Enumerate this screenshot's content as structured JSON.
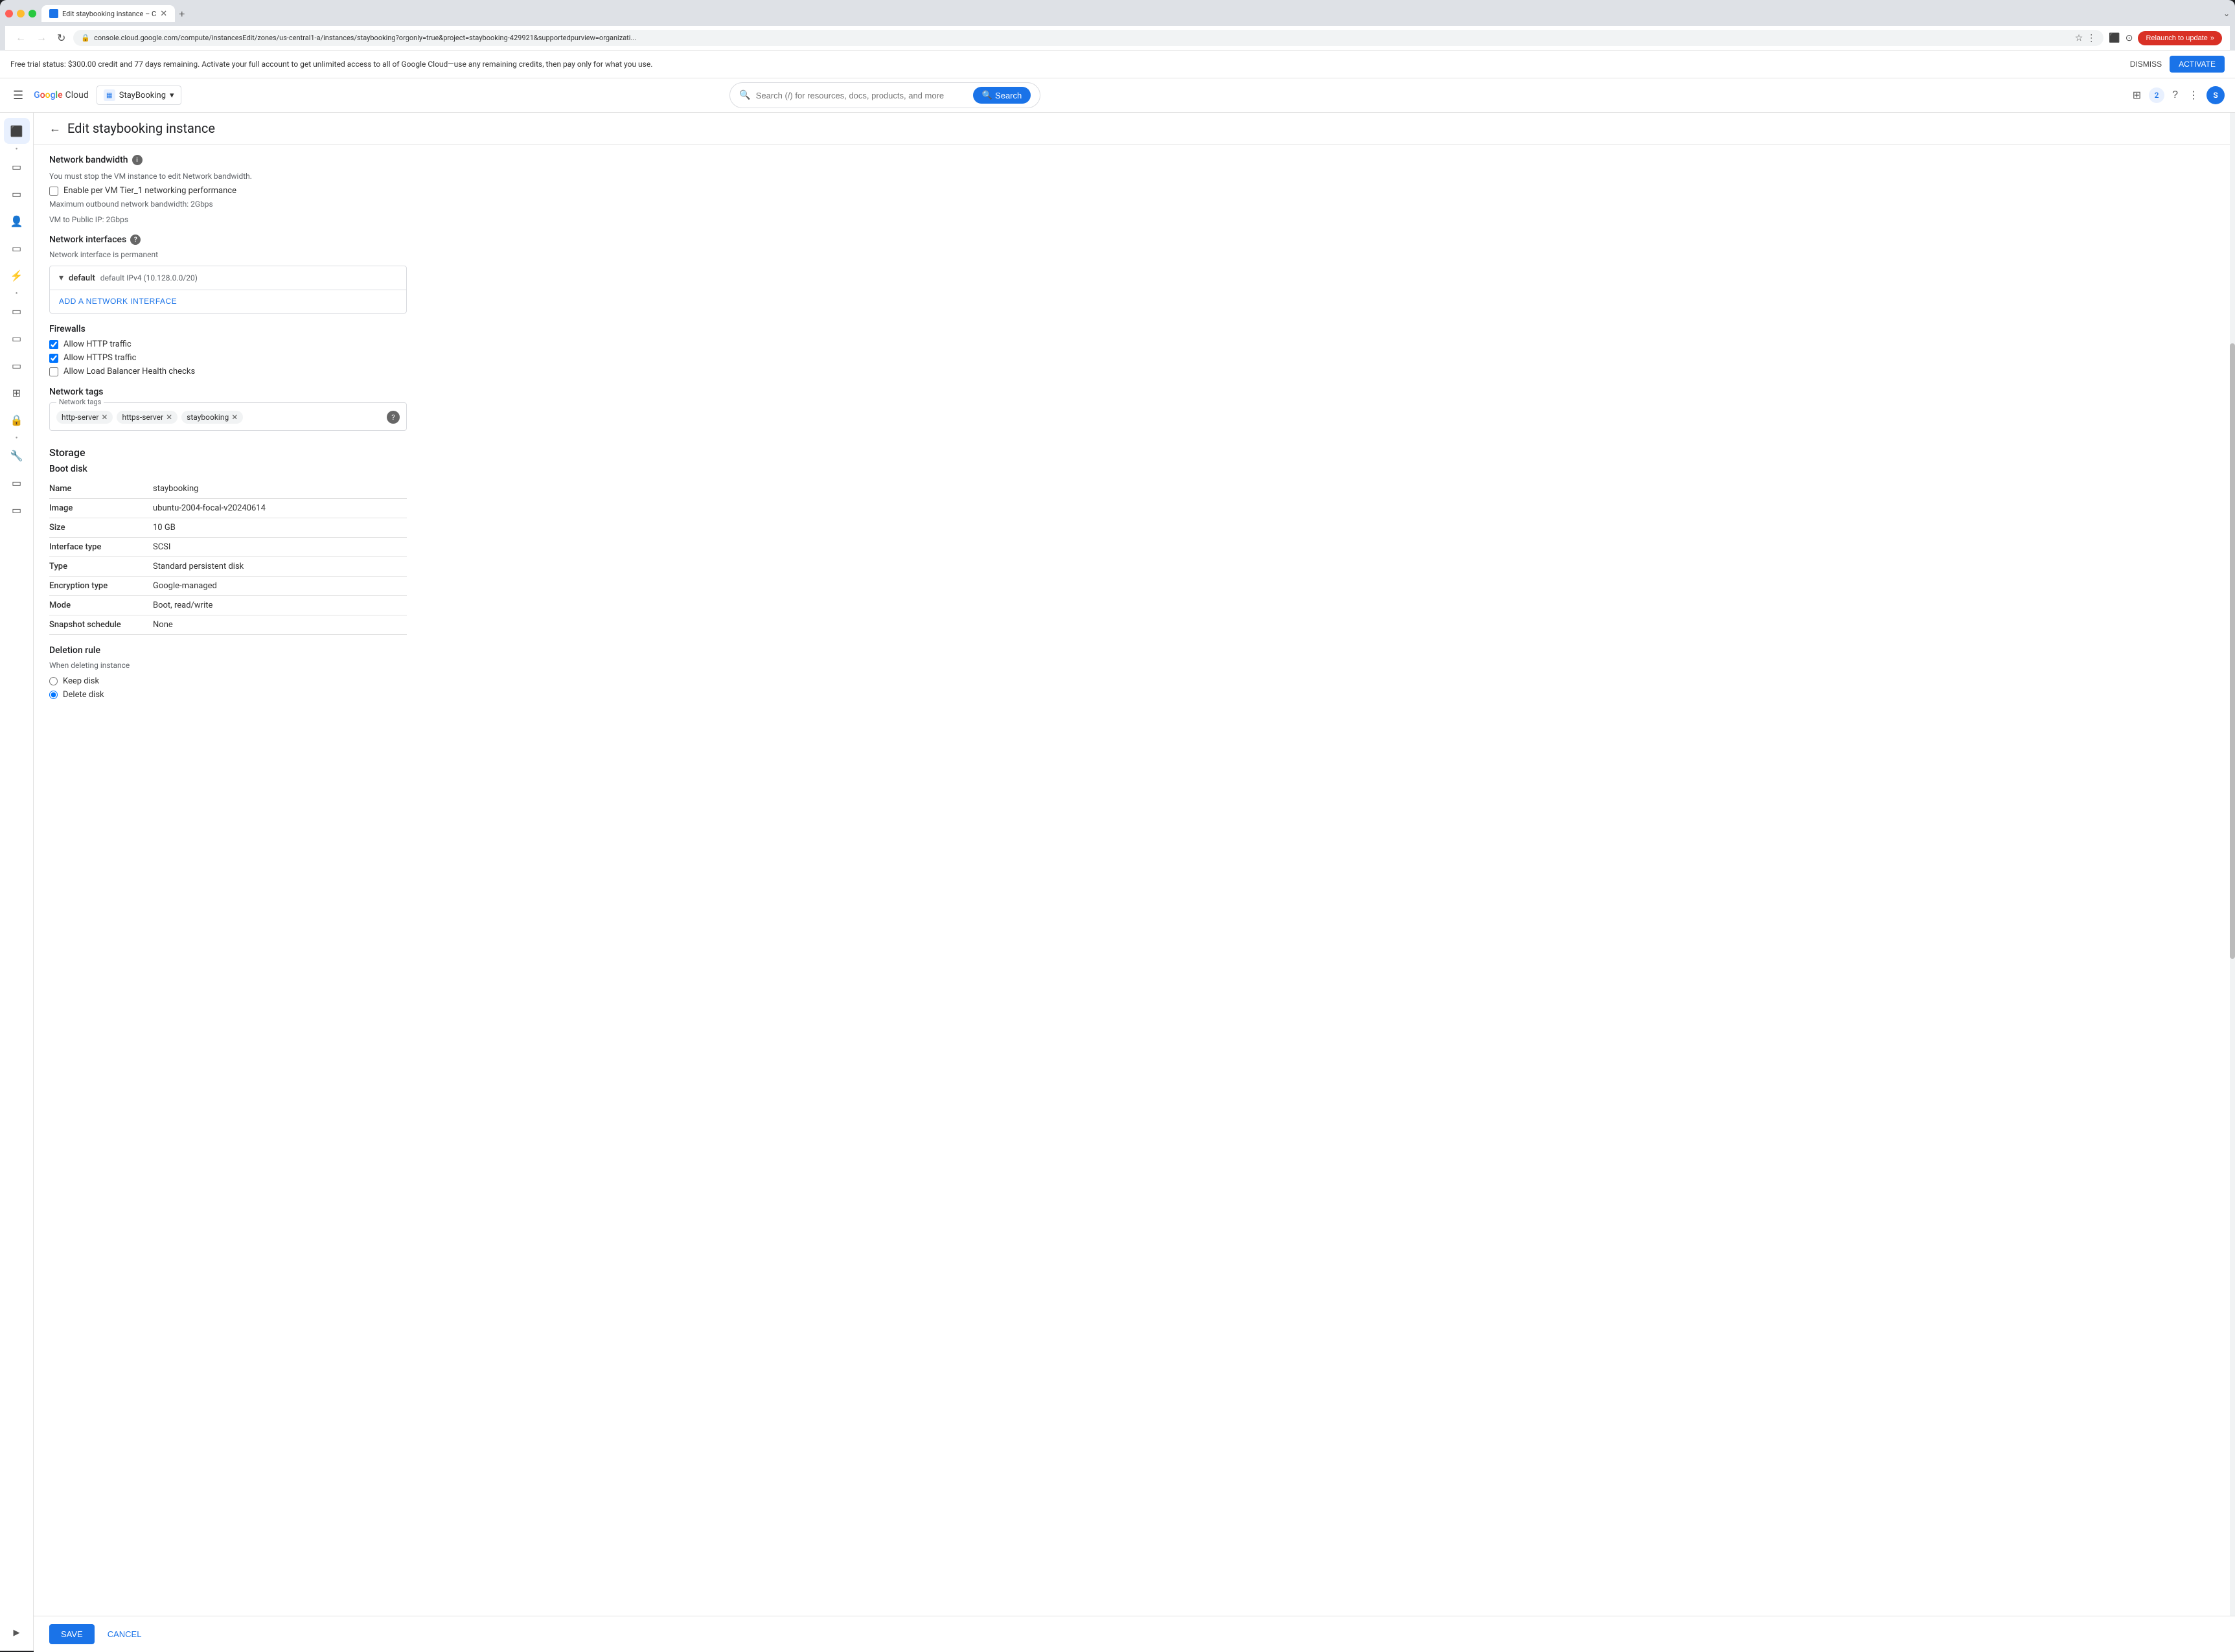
{
  "browser": {
    "tab_title": "Edit staybooking instance – C",
    "address": "console.cloud.google.com/compute/instancesEdit/zones/us-central1-a/instances/staybooking?orgonly=true&project=staybooking-429921&supportedpurview=organizati...",
    "relaunch_label": "Relaunch to update"
  },
  "banner": {
    "text": "Free trial status: $300.00 credit and 77 days remaining. Activate your full account to get unlimited access to all of Google Cloud—use any remaining credits, then pay only for what you use.",
    "dismiss_label": "DISMISS",
    "activate_label": "ACTIVATE"
  },
  "nav": {
    "project_name": "StayBooking",
    "search_placeholder": "Search (/) for resources, docs, products, and more",
    "search_label": "Search",
    "notifications_count": "2",
    "avatar_label": "S"
  },
  "page": {
    "title": "Edit staybooking instance",
    "back_tooltip": "Back"
  },
  "network_bandwidth": {
    "section_title": "Network bandwidth",
    "stop_note": "You must stop the VM instance to edit Network bandwidth.",
    "checkbox_label": "Enable per VM Tier_1 networking performance",
    "max_outbound": "Maximum outbound network bandwidth: 2Gbps",
    "vm_to_public": "VM to Public IP: 2Gbps"
  },
  "network_interfaces": {
    "section_title": "Network interfaces",
    "permanent_note": "Network interface is permanent",
    "interface_name": "default",
    "interface_detail": "default IPv4 (10.128.0.0/20)",
    "add_btn_label": "ADD A NETWORK INTERFACE"
  },
  "firewalls": {
    "section_title": "Firewalls",
    "items": [
      {
        "label": "Allow HTTP traffic",
        "checked": true
      },
      {
        "label": "Allow HTTPS traffic",
        "checked": true
      },
      {
        "label": "Allow Load Balancer Health checks",
        "checked": false
      }
    ]
  },
  "network_tags": {
    "section_title": "Network tags",
    "legend": "Network tags",
    "tags": [
      "http-server",
      "https-server",
      "staybooking"
    ]
  },
  "storage": {
    "section_title": "Storage",
    "boot_disk_title": "Boot disk",
    "fields": [
      {
        "label": "Name",
        "value": "staybooking"
      },
      {
        "label": "Image",
        "value": "ubuntu-2004-focal-v20240614"
      },
      {
        "label": "Size",
        "value": "10 GB"
      },
      {
        "label": "Interface type",
        "value": "SCSI"
      },
      {
        "label": "Type",
        "value": "Standard persistent disk"
      },
      {
        "label": "Encryption type",
        "value": "Google-managed"
      },
      {
        "label": "Mode",
        "value": "Boot, read/write"
      },
      {
        "label": "Snapshot schedule",
        "value": "None"
      }
    ]
  },
  "deletion": {
    "section_title": "Deletion rule",
    "sub_label": "When deleting instance",
    "options": [
      {
        "label": "Keep disk",
        "checked": false
      },
      {
        "label": "Delete disk",
        "checked": true
      }
    ]
  },
  "actions": {
    "save_label": "SAVE",
    "cancel_label": "CANCEL"
  },
  "sidebar": {
    "items": [
      {
        "icon": "⊞",
        "name": "home"
      },
      {
        "icon": "▭",
        "name": "instances"
      },
      {
        "icon": "▭",
        "name": "disks"
      },
      {
        "icon": "👤",
        "name": "iam"
      },
      {
        "icon": "▭",
        "name": "networking"
      },
      {
        "icon": "⚡",
        "name": "functions"
      }
    ]
  }
}
